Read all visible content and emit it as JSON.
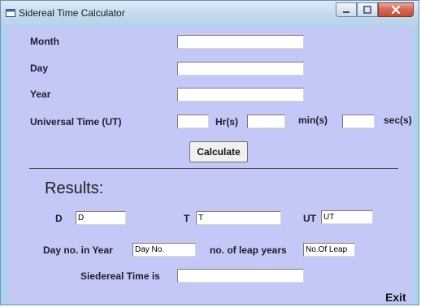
{
  "window": {
    "title": "Sidereal Time Calculator"
  },
  "form": {
    "month_label": "Month",
    "day_label": "Day",
    "year_label": "Year",
    "ut_label": "Universal Time (UT)",
    "hr_label": "Hr(s)",
    "min_label": "min(s)",
    "sec_label": "sec(s)",
    "month_value": "",
    "day_value": "",
    "year_value": "",
    "hr_value": "",
    "min_value": "",
    "sec_value": ""
  },
  "calculate_label": "Calculate",
  "results": {
    "heading": "Results:",
    "d_label": "D",
    "d_value": "D",
    "t_label": "T",
    "t_value": "T",
    "ut_label": "UT",
    "ut_value": "UT",
    "dayno_label": "Day no. in Year",
    "dayno_value": "Day No.",
    "leap_label": "no. of leap years",
    "leap_value": "No.Of Leap",
    "sidereal_label": "Siedereal Time is",
    "sidereal_value": ""
  },
  "exit_label": "Exit",
  "icons": [
    "app-icon",
    "minimize-icon",
    "maximize-icon",
    "close-icon"
  ]
}
